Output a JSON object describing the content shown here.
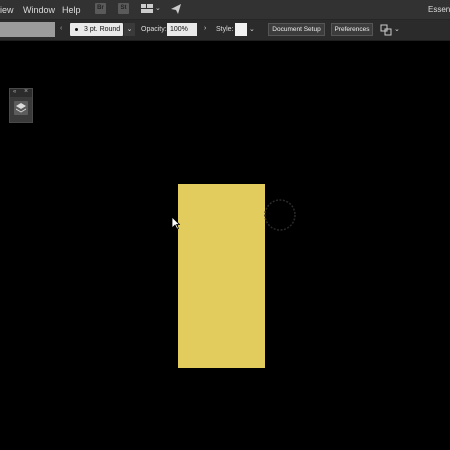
{
  "menubar": {
    "items": [
      "iew",
      "Window",
      "Help"
    ],
    "app_icons": [
      "Br",
      "St"
    ],
    "workspace": "Essenti"
  },
  "controlbar": {
    "brush": "3 pt. Round",
    "opacity_label": "Opacity:",
    "opacity_value": "100%",
    "style_label": "Style:",
    "document_setup": "Document Setup",
    "preferences": "Preferences"
  },
  "colors": {
    "fill": "#e2cc5e",
    "canvas": "#000000",
    "ui": "#323232"
  },
  "icons": [
    "workspace-switcher-icon",
    "send-icon",
    "layers-icon",
    "arrange-icon",
    "brush-cursor-icon",
    "pointer-cursor-icon"
  ]
}
